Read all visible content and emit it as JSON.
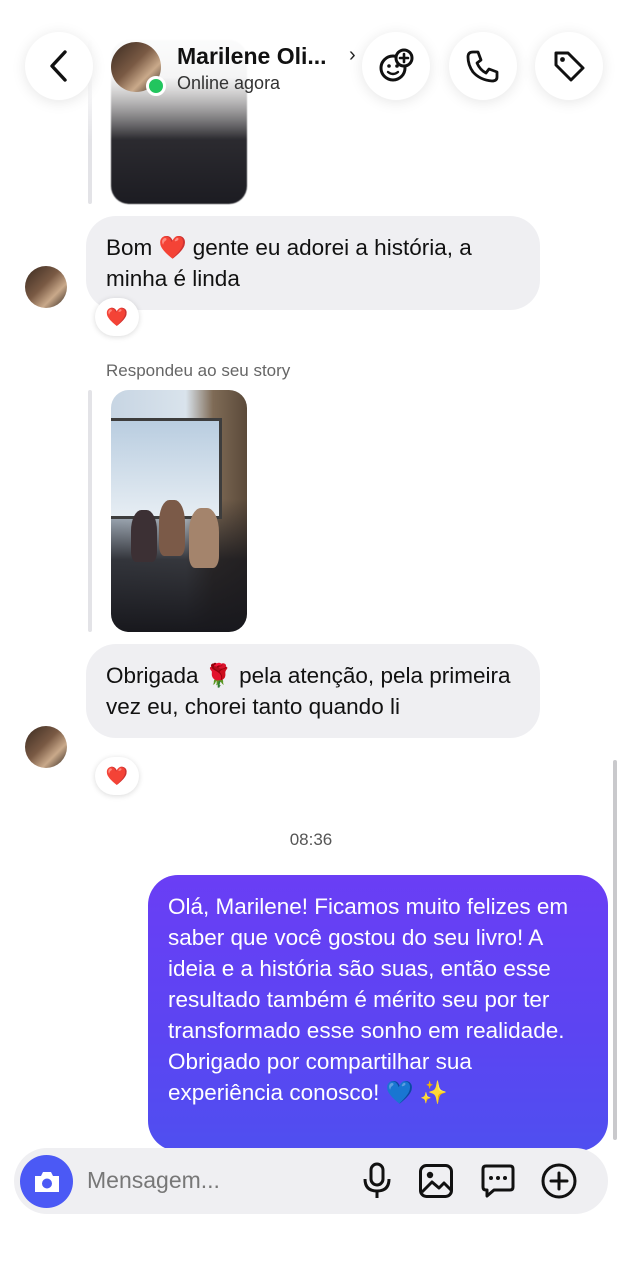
{
  "header": {
    "contact_name": "Marilene Oli...",
    "status": "Online agora",
    "chevron": "›"
  },
  "icons": {
    "back": "chevron-left-icon",
    "effects": "sticker-add-icon",
    "call": "phone-icon",
    "label": "tag-icon",
    "camera": "camera-icon",
    "mic": "microphone-icon",
    "gallery": "image-icon",
    "stickers": "chat-bubble-icon",
    "more": "plus-circle-icon"
  },
  "messages": {
    "m1": {
      "text": "Bom ❤️ gente eu adorei a história, a minha é linda",
      "reaction": "❤️"
    },
    "story_reply_label": "Respondeu ao seu story",
    "m2": {
      "text": "Obrigada 🌹 pela atenção, pela primeira vez eu, chorei tanto quando li",
      "reaction": "❤️"
    },
    "time": "08:36",
    "m3": {
      "text": "Olá, Marilene! Ficamos muito felizes em saber que você gostou do seu livro! A ideia e a história são suas, então esse resultado também é mérito seu por ter transformado esse sonho em realidade. Obrigado por compartilhar sua experiência conosco! 💙 ✨"
    }
  },
  "composer": {
    "placeholder": "Mensagem..."
  },
  "colors": {
    "outgoing_bubble": "#5b45f2",
    "incoming_bubble": "#efeff2",
    "camera_button": "#4b59f5",
    "online": "#22c55e"
  }
}
